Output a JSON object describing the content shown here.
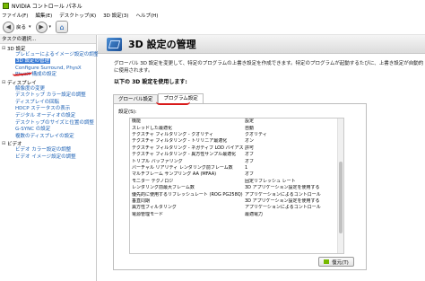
{
  "window": {
    "title": "NVIDIA コントロール パネル"
  },
  "menu": [
    "ファイル(F)",
    "編集(E)",
    "デスクトップ(K)",
    "3D 設定(3)",
    "ヘルプ(H)"
  ],
  "toolbar": {
    "back_label": "戻る",
    "caret": "▾"
  },
  "tasks": {
    "header": "タスクの選択...",
    "categories": [
      {
        "label": "3D 設定",
        "toggle": "⊟",
        "items": [
          "プレビューによるイメージ設定の調整",
          "3D 設定の管理",
          "Configure Surround, PhysX",
          "PhysX 構成の設定"
        ]
      },
      {
        "label": "ディスプレイ",
        "toggle": "⊟",
        "items": [
          "解像度の変更",
          "デスクトップ カラー設定の調整",
          "ディスプレイの回転",
          "HDCP ステータスの表示",
          "デジタル オーディオの設定",
          "デスクトップのサイズと位置の調整",
          "G-SYNC の設定",
          "複数のディスプレイの設定"
        ]
      },
      {
        "label": "ビデオ",
        "toggle": "⊟",
        "items": [
          "ビデオ カラー設定の調整",
          "ビデオ イメージ設定の調整"
        ]
      }
    ]
  },
  "main": {
    "title": "3D 設定の管理",
    "description": "グローバル 3D 設定を変更して、特定のプログラムの上書き設定を作成できます。特定のプログラムが起動するたびに、上書き設定が自動的に使用されます。",
    "section_heading": "以下の 3D 設定を使用します:",
    "tabs": [
      "グローバル設定",
      "プログラム設定"
    ],
    "settings_caption": "設定(S):",
    "columns": [
      "機能",
      "設定"
    ],
    "rows": [
      [
        "スレッドした最適化",
        "自動"
      ],
      [
        "テクスチャ フィルタリング - クオリティ",
        "クオリティ"
      ],
      [
        "テクスチャ フィルタリング - トリリニア最適化",
        "オン"
      ],
      [
        "テクスチャ フィルタリング - ネガティブ LOD バイアス",
        "許可"
      ],
      [
        "テクスチャ フィルタリング - 異方性サンプル最適化",
        "オフ"
      ],
      [
        "トリプル バッファリング",
        "オフ"
      ],
      [
        "バーチャル リアリティ レンダリング前フレーム数",
        "1"
      ],
      [
        "マルチフレーム サンプリング AA (MFAA)",
        "オフ"
      ],
      [
        "モニター テクノロジ",
        "固定リフレッシュ レート"
      ],
      [
        "レンダリング前最大フレーム数",
        "3D アプリケーション設定を使用する"
      ],
      [
        "優先的に使用するリフレッシュレート (ROG PG258Q)",
        "アプリケーションによるコントロール"
      ],
      [
        "垂直同期",
        "3D アプリケーション設定を使用する"
      ],
      [
        "異方性フィルタリング",
        "アプリケーションによるコントロール"
      ],
      [
        "電源管理モード",
        "最適電力"
      ]
    ],
    "restore_label": "復元(T)"
  },
  "colors": {
    "nvidia_green": "#76b900",
    "link_blue": "#1a5fb4",
    "annotation_red": "#d91a1a"
  }
}
